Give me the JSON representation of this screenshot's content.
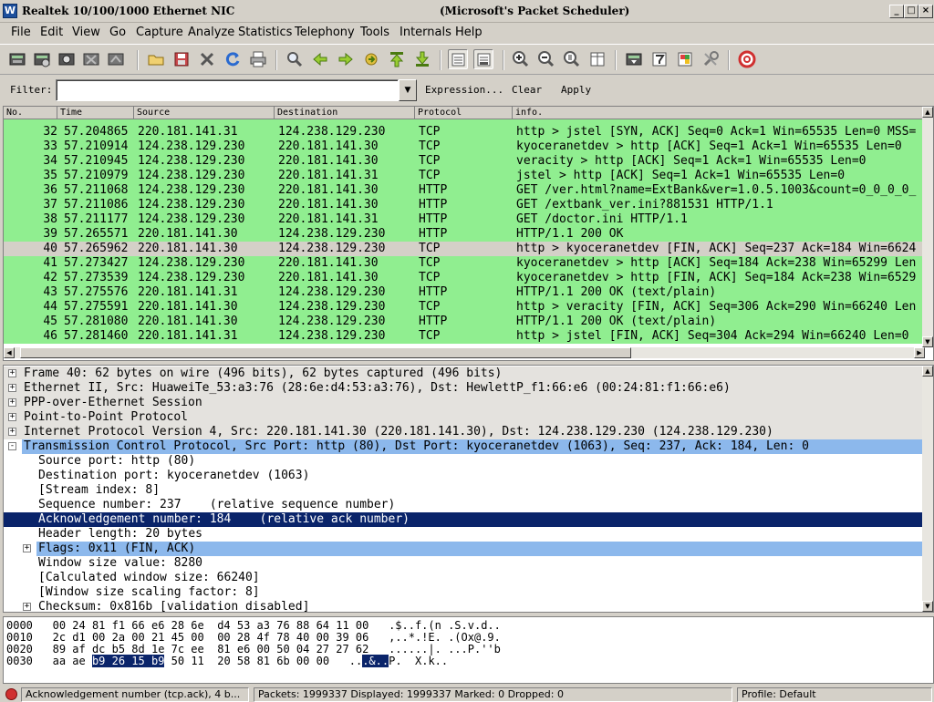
{
  "window": {
    "title": "Realtek 10/100/1000 Ethernet NIC",
    "caption": "(Microsoft's Packet Scheduler)",
    "buttons": [
      "_",
      "□",
      "×"
    ]
  },
  "menu": [
    "File",
    "Edit",
    "View",
    "Go",
    "Capture",
    "Analyze",
    "Statistics",
    "Telephony",
    "Tools",
    "Internals",
    "Help"
  ],
  "filter": {
    "label": "Filter:",
    "value": "",
    "expression": "Expression...",
    "clear": "Clear",
    "apply": "Apply"
  },
  "packet_list": {
    "columns": [
      "No.",
      "Time",
      "Source",
      "Destination",
      "Protocol",
      "info."
    ],
    "rows": [
      {
        "no": "32",
        "time": "57.204865",
        "src": "220.181.141.31",
        "dst": "124.238.129.230",
        "proto": "TCP",
        "info": "http > jstel [SYN, ACK] Seq=0 Ack=1 Win=65535 Len=0 MSS=",
        "selected": false
      },
      {
        "no": "33",
        "time": "57.210914",
        "src": "124.238.129.230",
        "dst": "220.181.141.30",
        "proto": "TCP",
        "info": "kyoceranetdev > http [ACK] Seq=1 Ack=1 Win=65535 Len=0",
        "selected": false
      },
      {
        "no": "34",
        "time": "57.210945",
        "src": "124.238.129.230",
        "dst": "220.181.141.30",
        "proto": "TCP",
        "info": "veracity > http [ACK] Seq=1 Ack=1 Win=65535 Len=0",
        "selected": false
      },
      {
        "no": "35",
        "time": "57.210979",
        "src": "124.238.129.230",
        "dst": "220.181.141.31",
        "proto": "TCP",
        "info": "jstel > http [ACK] Seq=1 Ack=1 Win=65535 Len=0",
        "selected": false
      },
      {
        "no": "36",
        "time": "57.211068",
        "src": "124.238.129.230",
        "dst": "220.181.141.30",
        "proto": "HTTP",
        "info": "GET /ver.html?name=ExtBank&ver=1.0.5.1003&count=0_0_0_0_",
        "selected": false
      },
      {
        "no": "37",
        "time": "57.211086",
        "src": "124.238.129.230",
        "dst": "220.181.141.30",
        "proto": "HTTP",
        "info": "GET /extbank_ver.ini?881531 HTTP/1.1",
        "selected": false
      },
      {
        "no": "38",
        "time": "57.211177",
        "src": "124.238.129.230",
        "dst": "220.181.141.31",
        "proto": "HTTP",
        "info": "GET /doctor.ini HTTP/1.1",
        "selected": false
      },
      {
        "no": "39",
        "time": "57.265571",
        "src": "220.181.141.30",
        "dst": "124.238.129.230",
        "proto": "HTTP",
        "info": "HTTP/1.1 200 OK",
        "selected": false
      },
      {
        "no": "40",
        "time": "57.265962",
        "src": "220.181.141.30",
        "dst": "124.238.129.230",
        "proto": "TCP",
        "info": "http > kyoceranetdev [FIN, ACK] Seq=237 Ack=184 Win=6624",
        "selected": true
      },
      {
        "no": "41",
        "time": "57.273427",
        "src": "124.238.129.230",
        "dst": "220.181.141.30",
        "proto": "TCP",
        "info": "kyoceranetdev > http [ACK] Seq=184 Ack=238 Win=65299 Len",
        "selected": false
      },
      {
        "no": "42",
        "time": "57.273539",
        "src": "124.238.129.230",
        "dst": "220.181.141.30",
        "proto": "TCP",
        "info": "kyoceranetdev > http [FIN, ACK] Seq=184 Ack=238 Win=6529",
        "selected": false
      },
      {
        "no": "43",
        "time": "57.275576",
        "src": "220.181.141.31",
        "dst": "124.238.129.230",
        "proto": "HTTP",
        "info": "HTTP/1.1 200 OK  (text/plain)",
        "selected": false
      },
      {
        "no": "44",
        "time": "57.275591",
        "src": "220.181.141.30",
        "dst": "124.238.129.230",
        "proto": "TCP",
        "info": "http > veracity [FIN, ACK] Seq=306 Ack=290 Win=66240 Len",
        "selected": false
      },
      {
        "no": "45",
        "time": "57.281080",
        "src": "220.181.141.30",
        "dst": "124.238.129.230",
        "proto": "HTTP",
        "info": "HTTP/1.1 200 OK  (text/plain)",
        "selected": false
      },
      {
        "no": "46",
        "time": "57.281460",
        "src": "220.181.141.31",
        "dst": "124.238.129.230",
        "proto": "TCP",
        "info": "http > jstel [FIN, ACK] Seq=304 Ack=294 Win=66240 Len=0",
        "selected": false
      }
    ]
  },
  "details": [
    {
      "indent": 0,
      "expander": "+",
      "text": "Frame 40: 62 bytes on wire (496 bits), 62 bytes captured (496 bits)",
      "style": "grey"
    },
    {
      "indent": 0,
      "expander": "+",
      "text": "Ethernet II, Src: HuaweiTe_53:a3:76 (28:6e:d4:53:a3:76), Dst: HewlettP_f1:66:e6 (00:24:81:f1:66:e6)",
      "style": "grey"
    },
    {
      "indent": 0,
      "expander": "+",
      "text": "PPP-over-Ethernet Session",
      "style": "grey"
    },
    {
      "indent": 0,
      "expander": "+",
      "text": "Point-to-Point Protocol",
      "style": "grey"
    },
    {
      "indent": 0,
      "expander": "+",
      "text": "Internet Protocol Version 4, Src: 220.181.141.30 (220.181.141.30), Dst: 124.238.129.230 (124.238.129.230)",
      "style": "grey"
    },
    {
      "indent": 0,
      "expander": "-",
      "text": "Transmission Control Protocol, Src Port: http (80), Dst Port: kyoceranetdev (1063), Seq: 237, Ack: 184, Len: 0",
      "style": "blue"
    },
    {
      "indent": 1,
      "expander": "",
      "text": "Source port: http (80)",
      "style": "plain"
    },
    {
      "indent": 1,
      "expander": "",
      "text": "Destination port: kyoceranetdev (1063)",
      "style": "plain"
    },
    {
      "indent": 1,
      "expander": "",
      "text": "[Stream index: 8]",
      "style": "plain"
    },
    {
      "indent": 1,
      "expander": "",
      "text": "Sequence number: 237    (relative sequence number)",
      "style": "plain"
    },
    {
      "indent": 1,
      "expander": "",
      "text": "Acknowledgement number: 184    (relative ack number)",
      "style": "selected"
    },
    {
      "indent": 1,
      "expander": "",
      "text": "Header length: 20 bytes",
      "style": "plain"
    },
    {
      "indent": 1,
      "expander": "+",
      "text": "Flags: 0x11 (FIN, ACK)",
      "style": "blue"
    },
    {
      "indent": 1,
      "expander": "",
      "text": "Window size value: 8280",
      "style": "plain"
    },
    {
      "indent": 1,
      "expander": "",
      "text": "[Calculated window size: 66240]",
      "style": "plain"
    },
    {
      "indent": 1,
      "expander": "",
      "text": "[Window size scaling factor: 8]",
      "style": "plain"
    },
    {
      "indent": 1,
      "expander": "+",
      "text": "Checksum: 0x816b [validation disabled]",
      "style": "plain"
    }
  ],
  "hex": [
    {
      "offset": "0000",
      "pre": "00 24 81 f1 66 e6 28 6e  d4 53 a3 76 88 64 11 00",
      "sel": "",
      "post": "",
      "ascii_pre": ".$..f.(n .S.v.d..",
      "ascii_sel": "",
      "ascii_post": ""
    },
    {
      "offset": "0010",
      "pre": "2c d1 00 2a 00 21 45 00  00 28 4f 78 40 00 39 06",
      "sel": "",
      "post": "",
      "ascii_pre": ",..*.!E. .(Ox@.9.",
      "ascii_sel": "",
      "ascii_post": ""
    },
    {
      "offset": "0020",
      "pre": "89 af dc b5 8d 1e 7c ee  81 e6 00 50 04 27 27 62",
      "sel": "",
      "post": "",
      "ascii_pre": "......|. ...P.''b",
      "ascii_sel": "",
      "ascii_post": ""
    },
    {
      "offset": "0030",
      "pre": "aa ae ",
      "sel": "b9 26 15 b9",
      "post": " 50 11  20 58 81 6b 00 00",
      "ascii_pre": "..",
      "ascii_sel": ".&..",
      "ascii_post": "P.  X.k.."
    }
  ],
  "status": {
    "field": "Acknowledgement number (tcp.ack), 4 b...",
    "packets": "Packets: 1999337 Displayed: 1999337 Marked: 0 Dropped: 0",
    "profile": "Profile: Default"
  },
  "colors": {
    "tcp_row": "#90ee90",
    "selected_row": "#d4d0c8",
    "tree_blue": "#8cb8ec",
    "tree_grey": "#e4e2de",
    "selection": "#0a246a"
  },
  "toolbar_icons": [
    "interface-list-icon",
    "capture-options-icon",
    "start-capture-icon",
    "stop-capture-icon",
    "restart-capture-icon",
    "open-file-icon",
    "save-file-icon",
    "close-file-icon",
    "reload-icon",
    "print-icon",
    "find-packet-icon",
    "go-back-icon",
    "go-forward-icon",
    "go-to-packet-icon",
    "go-first-icon",
    "go-last-icon",
    "colorize-icon",
    "autoscroll-icon",
    "zoom-in-icon",
    "zoom-out-icon",
    "normal-size-icon",
    "resize-columns-icon",
    "capture-filters-icon",
    "display-filters-icon",
    "coloring-rules-icon",
    "preferences-icon",
    "help-icon"
  ]
}
